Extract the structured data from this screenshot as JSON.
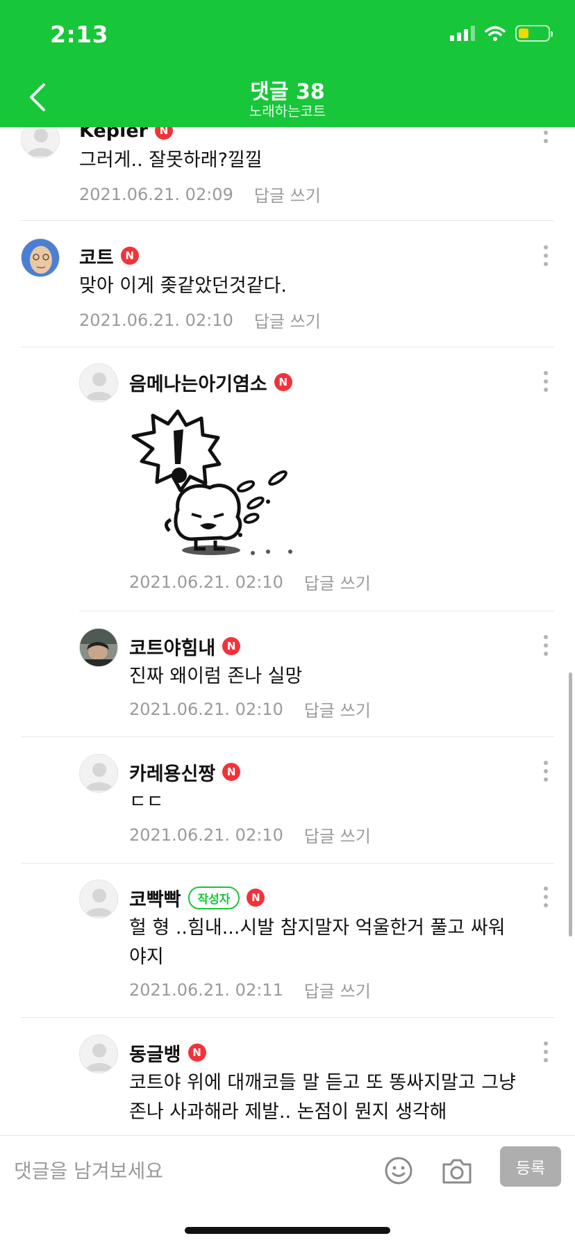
{
  "status_bar": {
    "time": "2:13"
  },
  "header": {
    "title": "댓글 38",
    "subtitle": "노래하는코트"
  },
  "n_badge": "N",
  "writer_badge": "작성자",
  "reply_label": "답글 쓰기",
  "comments": [
    {
      "author": "Kepler",
      "text": "그러게.. 잘못하래?낄낄",
      "date": "2021.06.21. 02:09"
    },
    {
      "author": "코트",
      "text": "맞아 이게 좆같았던것같다.",
      "date": "2021.06.21. 02:10"
    },
    {
      "author": "음메나는아기염소",
      "sticker": "sticker-image",
      "date": "2021.06.21. 02:10"
    },
    {
      "author": "코트야힘내",
      "text": "진짜 왜이럼 존나 실망",
      "date": "2021.06.21. 02:10"
    },
    {
      "author": "카레용신짱",
      "text": "ㄷㄷ",
      "date": "2021.06.21. 02:10"
    },
    {
      "author": "코빡빡",
      "text_line1": "헐 형 ..힘내...시발 참지말자 억울한거 풀고 싸워",
      "text_line2": "야지",
      "date": "2021.06.21. 02:11"
    },
    {
      "author": "동글뱅",
      "text_line1": "코트야 위에 대깨코들 말 듣고 또 똥싸지말고 그냥",
      "text_line2": "존나 사과해라 제발.. 논점이 뭔지 생각해"
    }
  ],
  "input": {
    "placeholder": "댓글을 남겨보세요",
    "submit_label": "등록"
  },
  "colors": {
    "brand_green": "#17c639",
    "badge_red": "#f2323a",
    "meta_gray": "#9a9a9a"
  },
  "icons": [
    "back-icon",
    "signal-icon",
    "wifi-icon",
    "battery-icon",
    "more-icon",
    "emoji-icon",
    "camera-icon",
    "default-avatar-icon"
  ]
}
